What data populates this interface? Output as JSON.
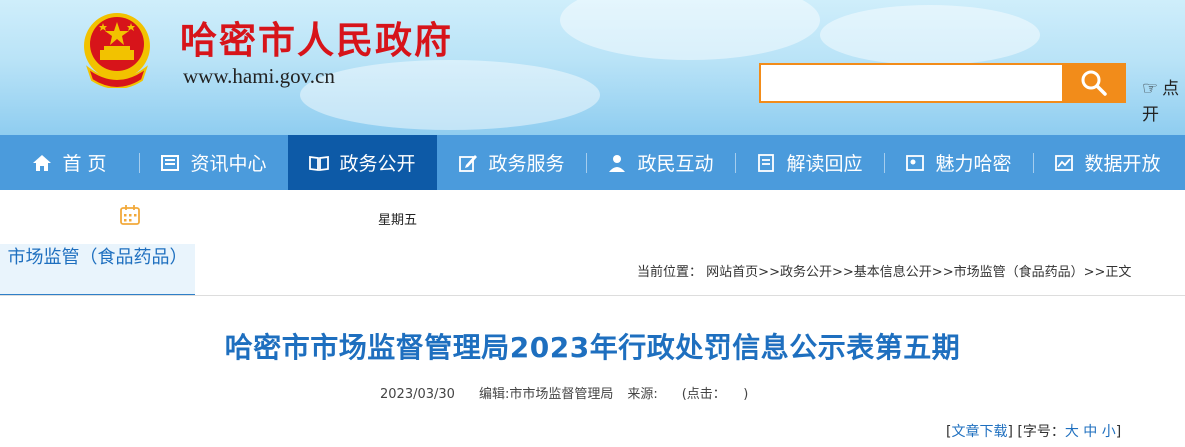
{
  "header": {
    "site_title": "哈密市人民政府",
    "site_url": "www.hami.gov.cn",
    "search": {
      "placeholder": ""
    },
    "open_hint_line1": "点",
    "open_hint_line2": "开"
  },
  "nav": {
    "items": [
      {
        "label": "首 页",
        "icon": "home-icon"
      },
      {
        "label": "资讯中心",
        "icon": "news-icon"
      },
      {
        "label": "政务公开",
        "icon": "book-icon",
        "active": true
      },
      {
        "label": "政务服务",
        "icon": "edit-icon"
      },
      {
        "label": "政民互动",
        "icon": "person-icon"
      },
      {
        "label": "解读回应",
        "icon": "document-icon"
      },
      {
        "label": "魅力哈密",
        "icon": "photo-icon"
      },
      {
        "label": "数据开放",
        "icon": "chart-icon"
      }
    ]
  },
  "date_row": {
    "weekday": "星期五"
  },
  "sidebar": {
    "tab_label": "市场监管（食品药品）"
  },
  "breadcrumb": {
    "prefix": "当前位置：",
    "items": [
      "网站首页",
      "政务公开",
      "基本信息公开",
      "市场监管（食品药品）",
      "正文"
    ],
    "separator": ">>"
  },
  "article": {
    "title": "哈密市市场监督管理局2023年行政处罚信息公示表第五期",
    "date": "2023/03/30",
    "editor": "编辑:市市场监督管理局",
    "source": "来源:",
    "clicks": "(点击：",
    "clicks_close": ")"
  },
  "tools": {
    "download": "文章下载",
    "font_size_label": "字号：",
    "sizes": [
      "大",
      "中",
      "小"
    ]
  },
  "colors": {
    "brand_red": "#d7141a",
    "nav_blue": "#4b9bdc",
    "nav_active": "#0d5aa7",
    "accent_orange": "#f28c1a",
    "title_blue": "#1e6fbf"
  }
}
